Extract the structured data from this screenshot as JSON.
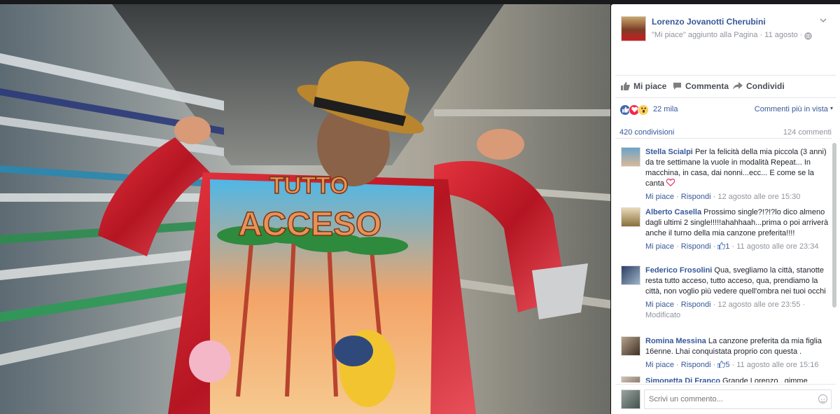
{
  "post": {
    "page_name": "Lorenzo Jovanotti Cherubini",
    "subtitle": "\"Mi piace\" aggiunto alla Pagina · 11 agosto ·",
    "photo_jacket_text_line1": "TUTTO",
    "photo_jacket_text_line2": "ACCESO"
  },
  "actions": {
    "like": "Mi piace",
    "comment": "Commenta",
    "share": "Condividi"
  },
  "reactions": {
    "count": "22 mila",
    "sort": "Commenti più in vista"
  },
  "counts": {
    "shares": "420 condivisioni",
    "comments": "124 commenti"
  },
  "comments": [
    {
      "author": "Stella Scialpi",
      "text": "Per la felicità della mia piccola (3 anni) da tre settimane la vuole in modalità Repeat... In macchina, in casa, dai nonni...ecc... E come se la canta",
      "like": "Mi piace",
      "reply": "Rispondi",
      "likes": "",
      "time": "12 agosto alle ore 15:30",
      "extra": ""
    },
    {
      "author": "Alberto Casella",
      "text": "Prossimo single?!?!?lo dico almeno dagli ultimi 2 single!!!!!ahahhaah...prima o poi arriverà anche il turno della mia canzone preferita!!!!",
      "like": "Mi piace",
      "reply": "Rispondi",
      "likes": "1",
      "time": "11 agosto alle ore 23:34",
      "extra": ""
    },
    {
      "author": "Federico Frosolini",
      "text": "Qua, svegliamo la città, stanotte resta tutto acceso, tutto acceso, qua, prendiamo la città, non voglio più vedere quell'ombra nei tuoi occhi",
      "like": "Mi piace",
      "reply": "Rispondi",
      "likes": "",
      "time": "12 agosto alle ore 23:55 ·",
      "extra": "Modificato"
    },
    {
      "author": "Romina Messina",
      "text": "La canzone preferita da mia figlia 16enne. Lhai conquistata proprio con questa .",
      "like": "Mi piace",
      "reply": "Rispondi",
      "likes": "5",
      "time": "11 agosto alle ore 15:16",
      "extra": ""
    },
    {
      "author": "Simonetta Di Franco",
      "text": "Grande Lorenzo.. gimme",
      "like": "",
      "reply": "",
      "likes": "",
      "time": "",
      "extra": ""
    }
  ],
  "composer": {
    "placeholder": "Scrivi un commento..."
  },
  "colors": {
    "link": "#365899",
    "meta": "#90949c",
    "text": "#1d2129",
    "like_blue": "#4267b2",
    "love_red": "#f0284a",
    "wow_yellow": "#fcd05b"
  }
}
